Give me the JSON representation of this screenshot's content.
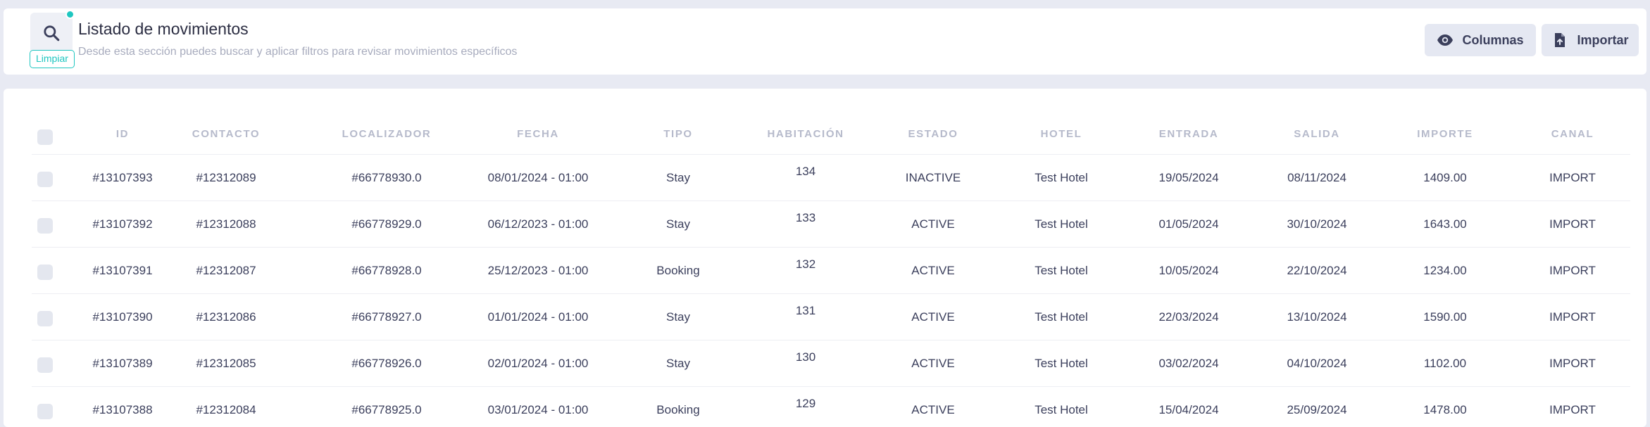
{
  "header": {
    "title": "Listado de movimientos",
    "subtitle": "Desde esta sección puedes buscar y aplicar filtros para revisar movimientos específicos",
    "clear_label": "Limpiar",
    "columns_label": "Columnas",
    "import_label": "Importar"
  },
  "table": {
    "columns": [
      "ID",
      "CONTACTO",
      "LOCALIZADOR",
      "FECHA",
      "TIPO",
      "HABITACIÓN",
      "ESTADO",
      "HOTEL",
      "ENTRADA",
      "SALIDA",
      "IMPORTE",
      "CANAL"
    ],
    "rows": [
      [
        "#13107393",
        "#12312089",
        "#66778930.0",
        "08/01/2024 - 01:00",
        "Stay",
        "134",
        "INACTIVE",
        "Test Hotel",
        "19/05/2024",
        "08/11/2024",
        "1409.00",
        "IMPORT"
      ],
      [
        "#13107392",
        "#12312088",
        "#66778929.0",
        "06/12/2023 - 01:00",
        "Stay",
        "133",
        "ACTIVE",
        "Test Hotel",
        "01/05/2024",
        "30/10/2024",
        "1643.00",
        "IMPORT"
      ],
      [
        "#13107391",
        "#12312087",
        "#66778928.0",
        "25/12/2023 - 01:00",
        "Booking",
        "132",
        "ACTIVE",
        "Test Hotel",
        "10/05/2024",
        "22/10/2024",
        "1234.00",
        "IMPORT"
      ],
      [
        "#13107390",
        "#12312086",
        "#66778927.0",
        "01/01/2024 - 01:00",
        "Stay",
        "131",
        "ACTIVE",
        "Test Hotel",
        "22/03/2024",
        "13/10/2024",
        "1590.00",
        "IMPORT"
      ],
      [
        "#13107389",
        "#12312085",
        "#66778926.0",
        "02/01/2024 - 01:00",
        "Stay",
        "130",
        "ACTIVE",
        "Test Hotel",
        "03/02/2024",
        "04/10/2024",
        "1102.00",
        "IMPORT"
      ],
      [
        "#13107388",
        "#12312084",
        "#66778925.0",
        "03/01/2024 - 01:00",
        "Booking",
        "129",
        "ACTIVE",
        "Test Hotel",
        "15/04/2024",
        "25/09/2024",
        "1478.00",
        "IMPORT"
      ]
    ]
  },
  "icons": {
    "search": "search-icon",
    "columns": "eye-icon",
    "import": "file-upload-icon"
  },
  "colors": {
    "accent": "#1ec6c0",
    "background": "#e8eaf3",
    "button_bg": "#e5e8f2"
  }
}
